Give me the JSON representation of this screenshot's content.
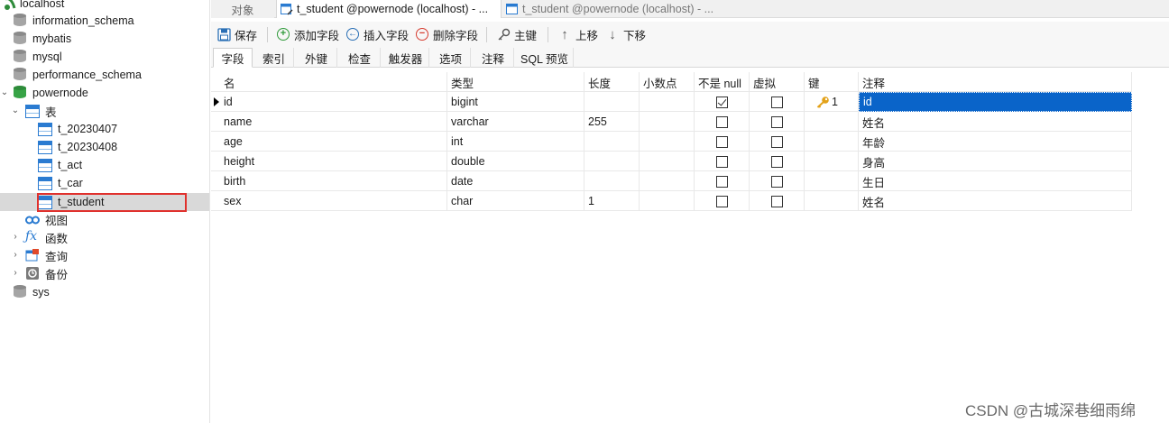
{
  "sidebar": {
    "items": [
      {
        "label": "localhost"
      },
      {
        "label": "information_schema"
      },
      {
        "label": "mybatis"
      },
      {
        "label": "mysql"
      },
      {
        "label": "performance_schema"
      },
      {
        "label": "powernode"
      },
      {
        "label": "表"
      },
      {
        "label": "t_20230407"
      },
      {
        "label": "t_20230408"
      },
      {
        "label": "t_act"
      },
      {
        "label": "t_car"
      },
      {
        "label": "t_student"
      },
      {
        "label": "视图"
      },
      {
        "label": "函数"
      },
      {
        "label": "查询"
      },
      {
        "label": "备份"
      },
      {
        "label": "sys"
      }
    ]
  },
  "tabs": [
    {
      "label": "对象"
    },
    {
      "label": "t_student @powernode (localhost) - ..."
    },
    {
      "label": "t_student @powernode (localhost) - ..."
    }
  ],
  "toolbar": {
    "save": "保存",
    "add_field": "添加字段",
    "insert_field": "插入字段",
    "delete_field": "删除字段",
    "primary_key": "主键",
    "move_up": "上移",
    "move_down": "下移"
  },
  "subtabs": [
    "字段",
    "索引",
    "外键",
    "检查",
    "触发器",
    "选项",
    "注释",
    "SQL 预览"
  ],
  "grid": {
    "columns": [
      "名",
      "类型",
      "长度",
      "小数点",
      "不是 null",
      "虚拟",
      "键",
      "注释"
    ],
    "rows": [
      {
        "name": "id",
        "type": "bigint",
        "length": "",
        "decimals": "",
        "not_null": true,
        "virtual": false,
        "key": "1",
        "comment": "id"
      },
      {
        "name": "name",
        "type": "varchar",
        "length": "255",
        "decimals": "",
        "not_null": false,
        "virtual": false,
        "key": "",
        "comment": "姓名"
      },
      {
        "name": "age",
        "type": "int",
        "length": "",
        "decimals": "",
        "not_null": false,
        "virtual": false,
        "key": "",
        "comment": "年龄"
      },
      {
        "name": "height",
        "type": "double",
        "length": "",
        "decimals": "",
        "not_null": false,
        "virtual": false,
        "key": "",
        "comment": "身高"
      },
      {
        "name": "birth",
        "type": "date",
        "length": "",
        "decimals": "",
        "not_null": false,
        "virtual": false,
        "key": "",
        "comment": "生日"
      },
      {
        "name": "sex",
        "type": "char",
        "length": "1",
        "decimals": "",
        "not_null": false,
        "virtual": false,
        "key": "",
        "comment": "姓名"
      }
    ]
  },
  "watermark": "CSDN @古城深巷细雨绵",
  "colors": {
    "selection": "#0a64c9",
    "highlight_box": "#e0312d",
    "table_icon": "#2a7bd1",
    "db_active": "#37a346"
  }
}
